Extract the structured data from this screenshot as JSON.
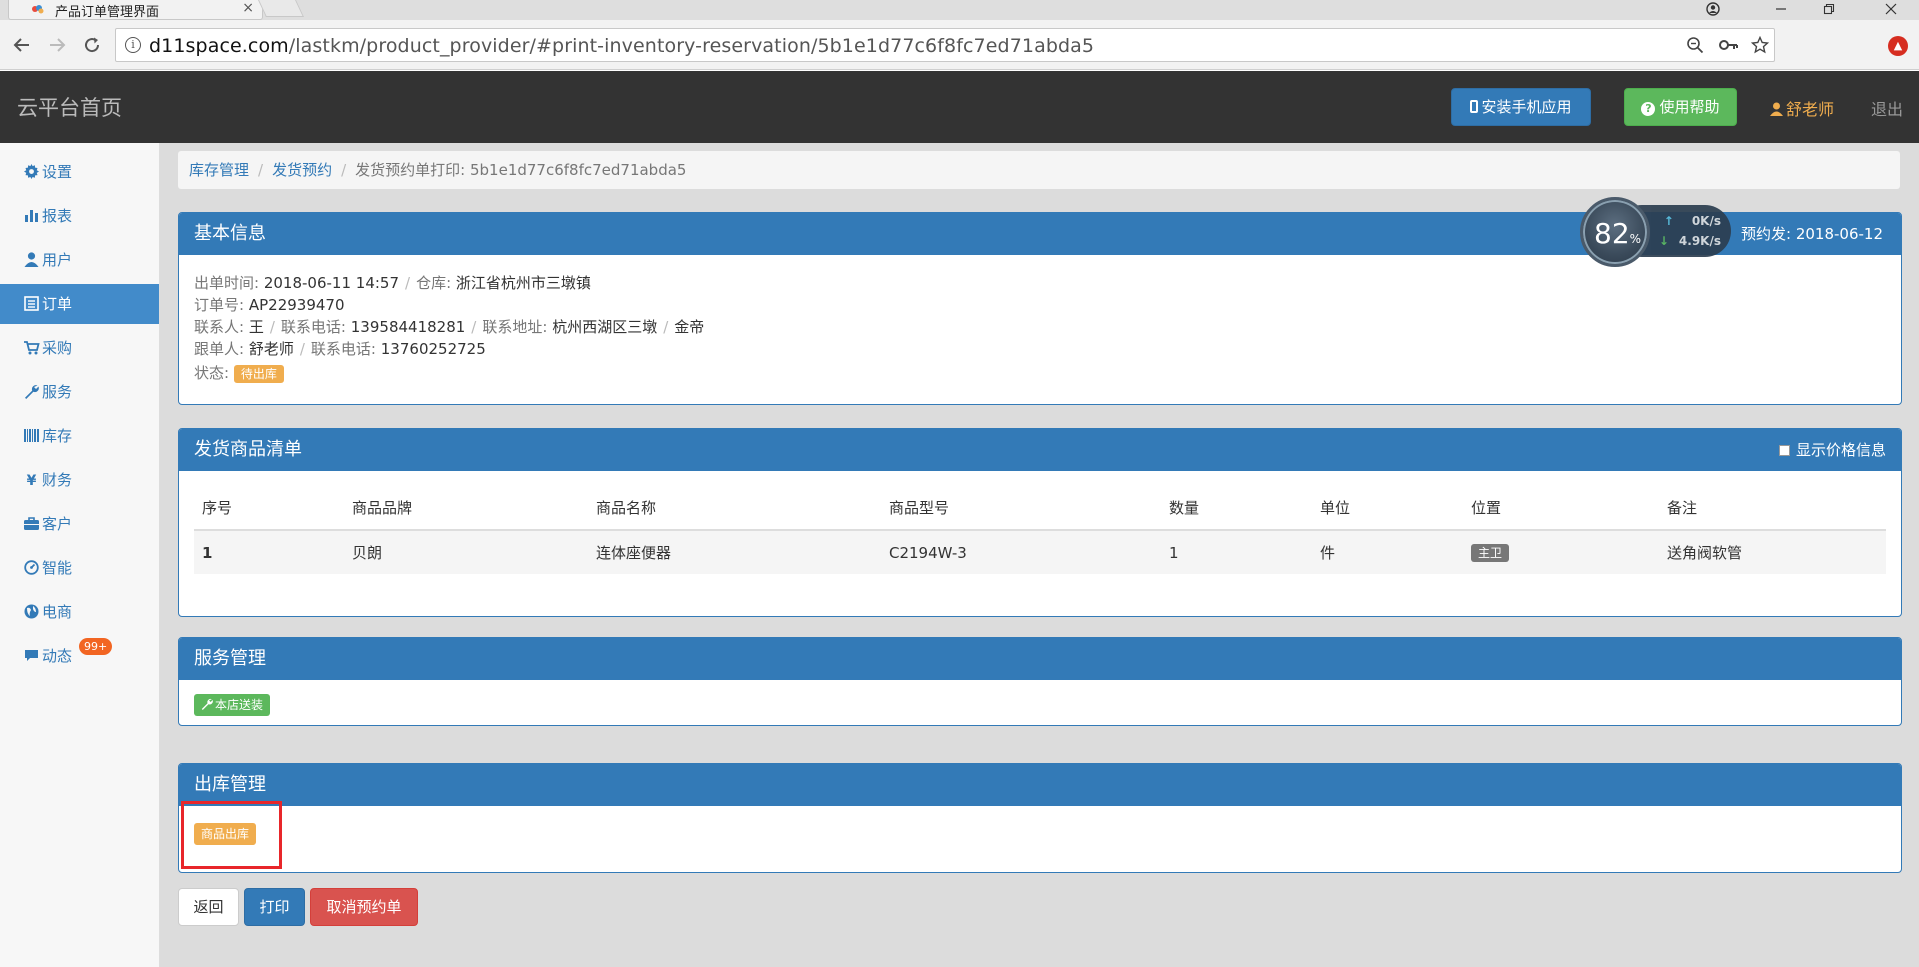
{
  "browser": {
    "tab_title": "产品订单管理界面",
    "tab_close": "×",
    "url_host": "d11space.com",
    "url_path": "/lastkm/product_provider/#print-inventory-reservation/5b1e1d77c6f8fc7ed71abda5"
  },
  "header": {
    "brand": "云平台首页",
    "install_app": "安装手机应用",
    "help": "使用帮助",
    "user": "舒老师",
    "logout": "退出"
  },
  "sidebar": {
    "items": [
      {
        "label": "设置",
        "icon": "gear-icon"
      },
      {
        "label": "报表",
        "icon": "bar-chart-icon"
      },
      {
        "label": "用户",
        "icon": "user-icon"
      },
      {
        "label": "订单",
        "icon": "list-icon",
        "active": true
      },
      {
        "label": "采购",
        "icon": "cart-icon"
      },
      {
        "label": "服务",
        "icon": "wrench-icon"
      },
      {
        "label": "库存",
        "icon": "barcode-icon"
      },
      {
        "label": "财务",
        "icon": "yen-icon"
      },
      {
        "label": "客户",
        "icon": "briefcase-icon"
      },
      {
        "label": "智能",
        "icon": "dashboard-icon"
      },
      {
        "label": "电商",
        "icon": "globe-icon"
      },
      {
        "label": "动态",
        "icon": "comment-icon",
        "badge": "99+"
      }
    ]
  },
  "breadcrumb": {
    "items": [
      "库存管理",
      "发货预约"
    ],
    "current": "发货预约单打印: 5b1e1d77c6f8fc7ed71abda5"
  },
  "basic_info": {
    "title": "基本信息",
    "reserve_label": "预约发",
    "reserve_date": "2018-06-12",
    "out_time_label": "出单时间:",
    "out_time": "2018-06-11 14:57",
    "warehouse_label": "仓库:",
    "warehouse": "浙江省杭州市三墩镇",
    "order_no_label": "订单号:",
    "order_no": "AP22939470",
    "contact_label": "联系人:",
    "contact": "王",
    "contact_phone_label": "联系电话:",
    "contact_phone": "139584418281",
    "address_label": "联系地址:",
    "address": "杭州西湖区三墩",
    "address_extra": "金帝",
    "follower_label": "跟单人:",
    "follower": "舒老师",
    "follower_phone_label": "联系电话:",
    "follower_phone": "13760252725",
    "status_label": "状态:",
    "status": "待出库"
  },
  "speed_widget": {
    "percent": "82",
    "percent_unit": "%",
    "up": "0K/s",
    "down": "4.9K/s"
  },
  "goods": {
    "title": "发货商品清单",
    "show_price": "显示价格信息",
    "columns": [
      "序号",
      "商品品牌",
      "商品名称",
      "商品型号",
      "数量",
      "单位",
      "位置",
      "备注"
    ],
    "rows": [
      {
        "no": "1",
        "brand": "贝朗",
        "name": "连体座便器",
        "model": "C2194W-3",
        "qty": "1",
        "unit": "件",
        "location": "主卫",
        "remark": "送角阀软管"
      }
    ]
  },
  "service": {
    "title": "服务管理",
    "tag": "本店送装"
  },
  "outbound": {
    "title": "出库管理",
    "tag": "商品出库"
  },
  "actions": {
    "back": "返回",
    "print": "打印",
    "cancel": "取消预约单"
  }
}
